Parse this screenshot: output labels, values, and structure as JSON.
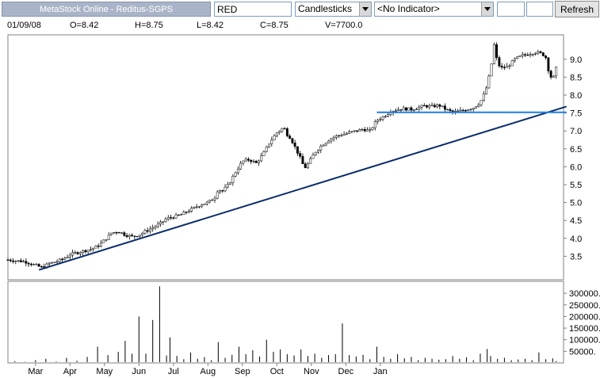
{
  "toolbar": {
    "title": "MetaStock Online - Reditus-SGPS",
    "symbol_value": "RED",
    "chart_type_selected": "Candlesticks",
    "indicator_selected": "<No Indicator>",
    "refresh_label": "Refresh"
  },
  "quote": {
    "date": "01/09/08",
    "open": "O=8.42",
    "high": "H=8.75",
    "low": "L=8.42",
    "close": "C=8.75",
    "volume": "V=7700.0"
  },
  "chart_data": {
    "type": "candlestick",
    "price_ticks": [
      3.5,
      4.0,
      4.5,
      5.0,
      5.5,
      6.0,
      6.5,
      7.0,
      7.5,
      8.0,
      8.5,
      9.0
    ],
    "price_tick_labels": [
      "3.5",
      "4.0",
      "4.5",
      "5.0",
      "5.5",
      "6.0",
      "6.5",
      "7.0",
      "7.5",
      "8.0",
      "8.5",
      "9.0"
    ],
    "volume_ticks": [
      50000,
      100000,
      150000,
      200000,
      250000,
      300000
    ],
    "volume_tick_labels": [
      "50000.",
      "100000.",
      "150000.",
      "200000.",
      "250000.",
      "300000."
    ],
    "month_labels": [
      "Mar",
      "Apr",
      "May",
      "Jun",
      "Jul",
      "Aug",
      "Sep",
      "Oct",
      "Nov",
      "Dec",
      "Jan"
    ],
    "close_path": [
      [
        0,
        3.4
      ],
      [
        0.3,
        3.37
      ],
      [
        0.5,
        3.35
      ],
      [
        0.7,
        3.28
      ],
      [
        1.0,
        3.18
      ],
      [
        1.2,
        3.3
      ],
      [
        1.4,
        3.35
      ],
      [
        1.6,
        3.42
      ],
      [
        1.8,
        3.55
      ],
      [
        2.0,
        3.6
      ],
      [
        2.2,
        3.65
      ],
      [
        2.4,
        3.7
      ],
      [
        2.6,
        3.78
      ],
      [
        2.8,
        3.95
      ],
      [
        3.0,
        4.15
      ],
      [
        3.2,
        4.2
      ],
      [
        3.4,
        4.1
      ],
      [
        3.6,
        4.05
      ],
      [
        3.8,
        4.1
      ],
      [
        4.0,
        4.2
      ],
      [
        4.2,
        4.3
      ],
      [
        4.4,
        4.4
      ],
      [
        4.6,
        4.55
      ],
      [
        4.8,
        4.6
      ],
      [
        5.0,
        4.65
      ],
      [
        5.2,
        4.75
      ],
      [
        5.4,
        4.85
      ],
      [
        5.6,
        4.95
      ],
      [
        5.8,
        5.0
      ],
      [
        6.0,
        5.15
      ],
      [
        6.1,
        5.4
      ],
      [
        6.2,
        5.3
      ],
      [
        6.4,
        5.5
      ],
      [
        6.6,
        5.85
      ],
      [
        6.8,
        6.15
      ],
      [
        7.0,
        6.2
      ],
      [
        7.2,
        6.1
      ],
      [
        7.4,
        6.35
      ],
      [
        7.6,
        6.7
      ],
      [
        7.8,
        6.95
      ],
      [
        8.0,
        7.1
      ],
      [
        8.1,
        6.9
      ],
      [
        8.2,
        6.8
      ],
      [
        8.35,
        6.5
      ],
      [
        8.5,
        6.2
      ],
      [
        8.6,
        5.95
      ],
      [
        8.75,
        6.15
      ],
      [
        8.9,
        6.4
      ],
      [
        9.1,
        6.6
      ],
      [
        9.3,
        6.75
      ],
      [
        9.5,
        6.85
      ],
      [
        9.7,
        6.9
      ],
      [
        9.9,
        6.95
      ],
      [
        10.1,
        7.0
      ],
      [
        10.3,
        7.05
      ],
      [
        10.5,
        7.0
      ],
      [
        10.7,
        7.3
      ],
      [
        10.9,
        7.4
      ],
      [
        11.1,
        7.55
      ],
      [
        11.3,
        7.6
      ],
      [
        11.5,
        7.62
      ],
      [
        11.7,
        7.6
      ],
      [
        11.9,
        7.65
      ],
      [
        12.1,
        7.7
      ],
      [
        12.3,
        7.68
      ],
      [
        12.5,
        7.72
      ],
      [
        12.7,
        7.6
      ],
      [
        12.9,
        7.52
      ],
      [
        13.1,
        7.55
      ],
      [
        13.3,
        7.6
      ],
      [
        13.5,
        7.65
      ],
      [
        13.7,
        7.8
      ],
      [
        13.85,
        8.1
      ],
      [
        14.0,
        8.7
      ],
      [
        14.1,
        9.4
      ],
      [
        14.2,
        8.9
      ],
      [
        14.3,
        8.75
      ],
      [
        14.5,
        8.8
      ],
      [
        14.7,
        9.0
      ],
      [
        14.9,
        9.1
      ],
      [
        15.1,
        9.15
      ],
      [
        15.3,
        9.2
      ],
      [
        15.5,
        9.15
      ],
      [
        15.6,
        9.05
      ],
      [
        15.7,
        8.6
      ],
      [
        15.8,
        8.42
      ],
      [
        15.9,
        8.75
      ]
    ],
    "trendline": {
      "x1": 0.9,
      "y1": 3.12,
      "x2": 16.2,
      "y2": 7.68
    },
    "resistance_line": {
      "x1": 10.7,
      "y1": 7.52,
      "x2": 16.2,
      "y2": 7.52
    },
    "volume_bars": [
      [
        0.2,
        8000
      ],
      [
        0.5,
        5000
      ],
      [
        0.8,
        12000
      ],
      [
        1.1,
        18000
      ],
      [
        1.4,
        6000
      ],
      [
        1.7,
        22000
      ],
      [
        2.0,
        10000
      ],
      [
        2.3,
        26000
      ],
      [
        2.6,
        70000
      ],
      [
        2.9,
        34000
      ],
      [
        3.2,
        48000
      ],
      [
        3.4,
        95000
      ],
      [
        3.6,
        40000
      ],
      [
        3.8,
        200000
      ],
      [
        4.0,
        40000
      ],
      [
        4.2,
        185000
      ],
      [
        4.4,
        330000
      ],
      [
        4.6,
        32000
      ],
      [
        4.7,
        110000
      ],
      [
        4.9,
        30000
      ],
      [
        5.1,
        16000
      ],
      [
        5.3,
        45000
      ],
      [
        5.5,
        18000
      ],
      [
        5.7,
        25000
      ],
      [
        5.9,
        12000
      ],
      [
        6.1,
        90000
      ],
      [
        6.3,
        22000
      ],
      [
        6.5,
        35000
      ],
      [
        6.7,
        70000
      ],
      [
        6.9,
        38000
      ],
      [
        7.1,
        55000
      ],
      [
        7.3,
        28000
      ],
      [
        7.5,
        100000
      ],
      [
        7.7,
        48000
      ],
      [
        7.9,
        58000
      ],
      [
        8.1,
        38000
      ],
      [
        8.3,
        32000
      ],
      [
        8.5,
        58000
      ],
      [
        8.7,
        30000
      ],
      [
        8.9,
        40000
      ],
      [
        9.1,
        22000
      ],
      [
        9.3,
        34000
      ],
      [
        9.5,
        38000
      ],
      [
        9.7,
        170000
      ],
      [
        9.9,
        34000
      ],
      [
        10.1,
        28000
      ],
      [
        10.3,
        35000
      ],
      [
        10.5,
        16000
      ],
      [
        10.7,
        70000
      ],
      [
        10.9,
        26000
      ],
      [
        11.1,
        18000
      ],
      [
        11.3,
        38000
      ],
      [
        11.5,
        20000
      ],
      [
        11.7,
        26000
      ],
      [
        11.9,
        12000
      ],
      [
        12.1,
        22000
      ],
      [
        12.3,
        18000
      ],
      [
        12.5,
        14000
      ],
      [
        12.7,
        16000
      ],
      [
        12.9,
        30000
      ],
      [
        13.1,
        18000
      ],
      [
        13.3,
        24000
      ],
      [
        13.5,
        12000
      ],
      [
        13.7,
        40000
      ],
      [
        13.9,
        60000
      ],
      [
        14.0,
        30000
      ],
      [
        14.2,
        18000
      ],
      [
        14.4,
        22000
      ],
      [
        14.6,
        12000
      ],
      [
        14.8,
        15000
      ],
      [
        15.0,
        18000
      ],
      [
        15.2,
        12000
      ],
      [
        15.4,
        45000
      ],
      [
        15.6,
        16000
      ],
      [
        15.8,
        20000
      ],
      [
        15.9,
        8000
      ]
    ]
  }
}
